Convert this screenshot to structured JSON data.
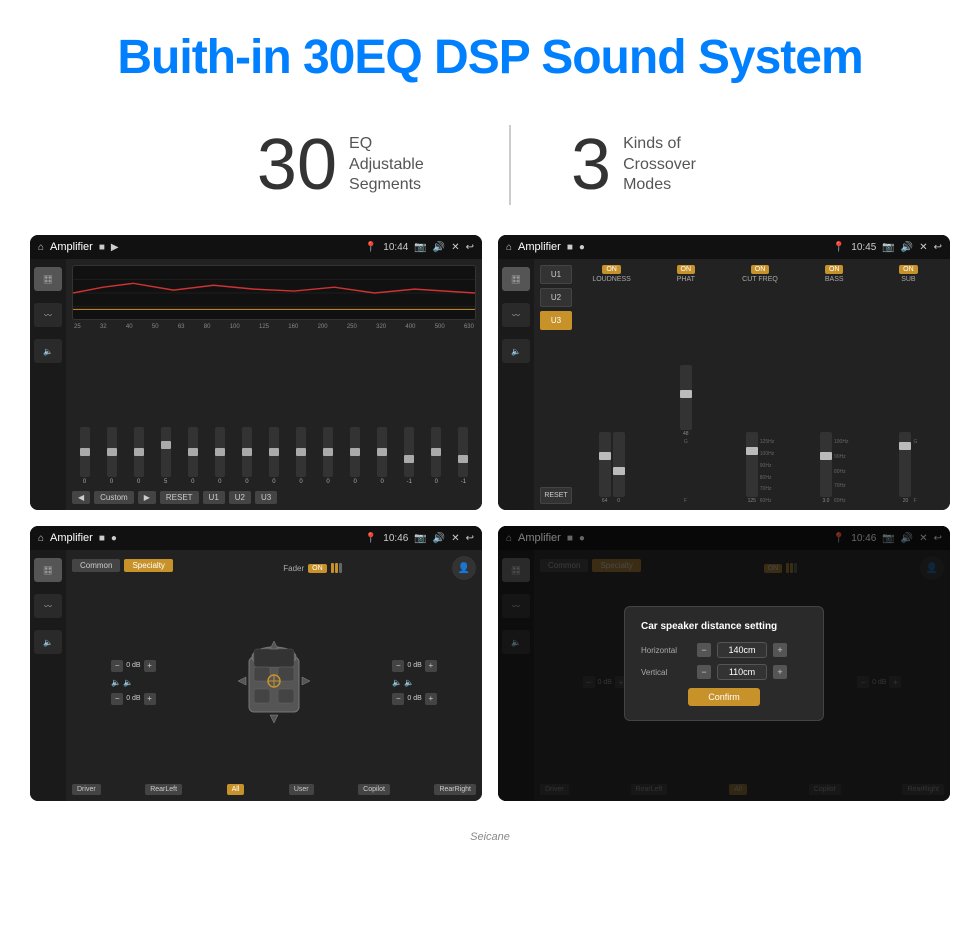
{
  "header": {
    "title": "Buith-in 30EQ DSP Sound System"
  },
  "stats": [
    {
      "number": "30",
      "label": "EQ Adjustable\nSegments"
    },
    {
      "number": "3",
      "label": "Kinds of\nCrossover Modes"
    }
  ],
  "screen1": {
    "title": "Amplifier",
    "time": "10:44",
    "eq_labels": [
      "25",
      "32",
      "40",
      "50",
      "63",
      "80",
      "100",
      "125",
      "160",
      "200",
      "250",
      "320",
      "400",
      "500",
      "630"
    ],
    "eq_values": [
      0,
      0,
      0,
      5,
      0,
      0,
      0,
      0,
      0,
      0,
      0,
      0,
      -1,
      0,
      -1
    ],
    "controls": [
      "Custom",
      "RESET",
      "U1",
      "U2",
      "U3"
    ]
  },
  "screen2": {
    "title": "Amplifier",
    "time": "10:45",
    "presets": [
      "U1",
      "U2",
      "U3"
    ],
    "active_preset": "U3",
    "channels": [
      "LOUDNESS",
      "PHAT",
      "CUT FREQ",
      "BASS",
      "SUB"
    ],
    "channel_on": [
      true,
      true,
      true,
      true,
      true
    ]
  },
  "screen3": {
    "title": "Amplifier",
    "time": "10:46",
    "tabs": [
      "Common",
      "Specialty"
    ],
    "active_tab": "Specialty",
    "fader_label": "Fader",
    "fader_on": "ON",
    "positions": [
      "Driver",
      "RearLeft",
      "All",
      "User",
      "Copilot",
      "RearRight"
    ],
    "active_position": "All",
    "db_values": [
      "0 dB",
      "0 dB",
      "0 dB",
      "0 dB"
    ]
  },
  "screen4": {
    "title": "Amplifier",
    "time": "10:46",
    "tabs": [
      "Common",
      "Specialty"
    ],
    "active_tab": "Specialty",
    "modal": {
      "title": "Car speaker distance setting",
      "horizontal_label": "Horizontal",
      "horizontal_value": "140cm",
      "vertical_label": "Vertical",
      "vertical_value": "110cm",
      "confirm_label": "Confirm"
    },
    "positions": [
      "Driver",
      "RearLeft",
      "All",
      "User",
      "Copilot",
      "RearRight"
    ],
    "db_values": [
      "0 dB",
      "0 dB"
    ]
  },
  "watermark": "Seicane"
}
